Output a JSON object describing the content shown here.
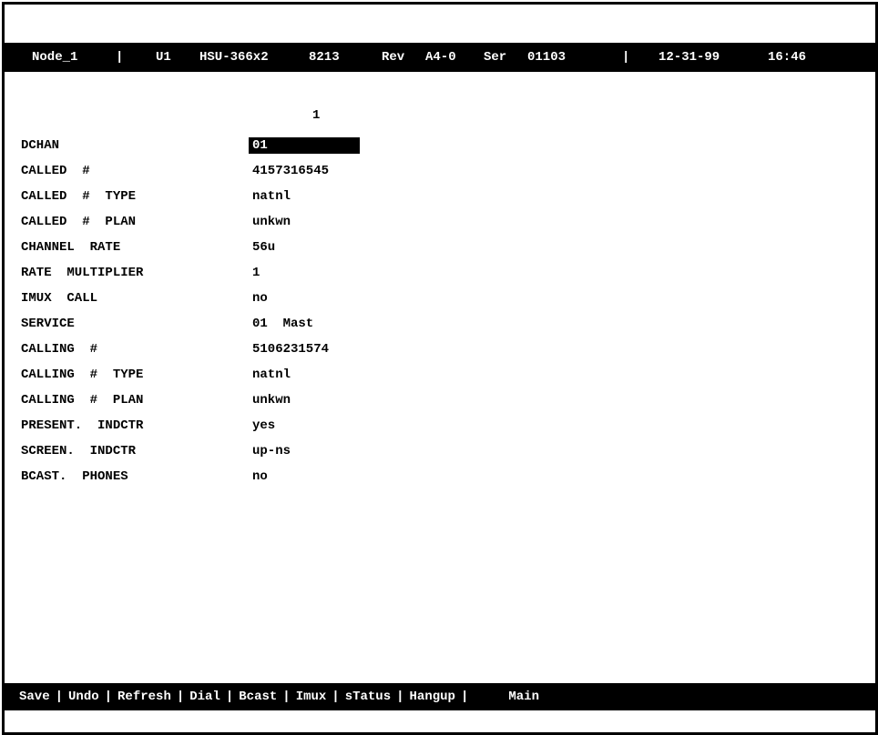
{
  "header": {
    "node": "Node_1",
    "slot": "U1",
    "card": "HSU-366x2",
    "code": "8213",
    "rev_label": "Rev",
    "rev": "A4-0",
    "ser_label": "Ser",
    "serial": "01103",
    "date": "12-31-99",
    "time": "16:46",
    "separator": "|"
  },
  "table": {
    "column_header": "1",
    "rows": [
      {
        "label": "DCHAN",
        "value": "01"
      },
      {
        "label": "CALLED  #",
        "value": "4157316545"
      },
      {
        "label": "CALLED  #  TYPE",
        "value": "natnl"
      },
      {
        "label": "CALLED  #  PLAN",
        "value": "unkwn"
      },
      {
        "label": "CHANNEL  RATE",
        "value": "56u"
      },
      {
        "label": "RATE  MULTIPLIER",
        "value": "1"
      },
      {
        "label": "IMUX  CALL",
        "value": "no"
      },
      {
        "label": "SERVICE",
        "value": "01  Mast"
      },
      {
        "label": "CALLING  #",
        "value": "5106231574"
      },
      {
        "label": "CALLING  #  TYPE",
        "value": "natnl"
      },
      {
        "label": "CALLING  #  PLAN",
        "value": "unkwn"
      },
      {
        "label": "PRESENT.  INDCTR",
        "value": "yes"
      },
      {
        "label": "SCREEN.  INDCTR",
        "value": "up-ns"
      },
      {
        "label": "BCAST.  PHONES",
        "value": "no"
      }
    ]
  },
  "menu": {
    "separator": "|",
    "items": [
      "Save",
      "Undo",
      "Refresh",
      "Dial",
      "Bcast",
      "Imux",
      "sTatus",
      "Hangup"
    ],
    "main": "Main"
  },
  "colors": {
    "bar_background": "#000000",
    "bar_text": "#ffffff",
    "screen_background": "#ffffff",
    "text": "#000000"
  }
}
